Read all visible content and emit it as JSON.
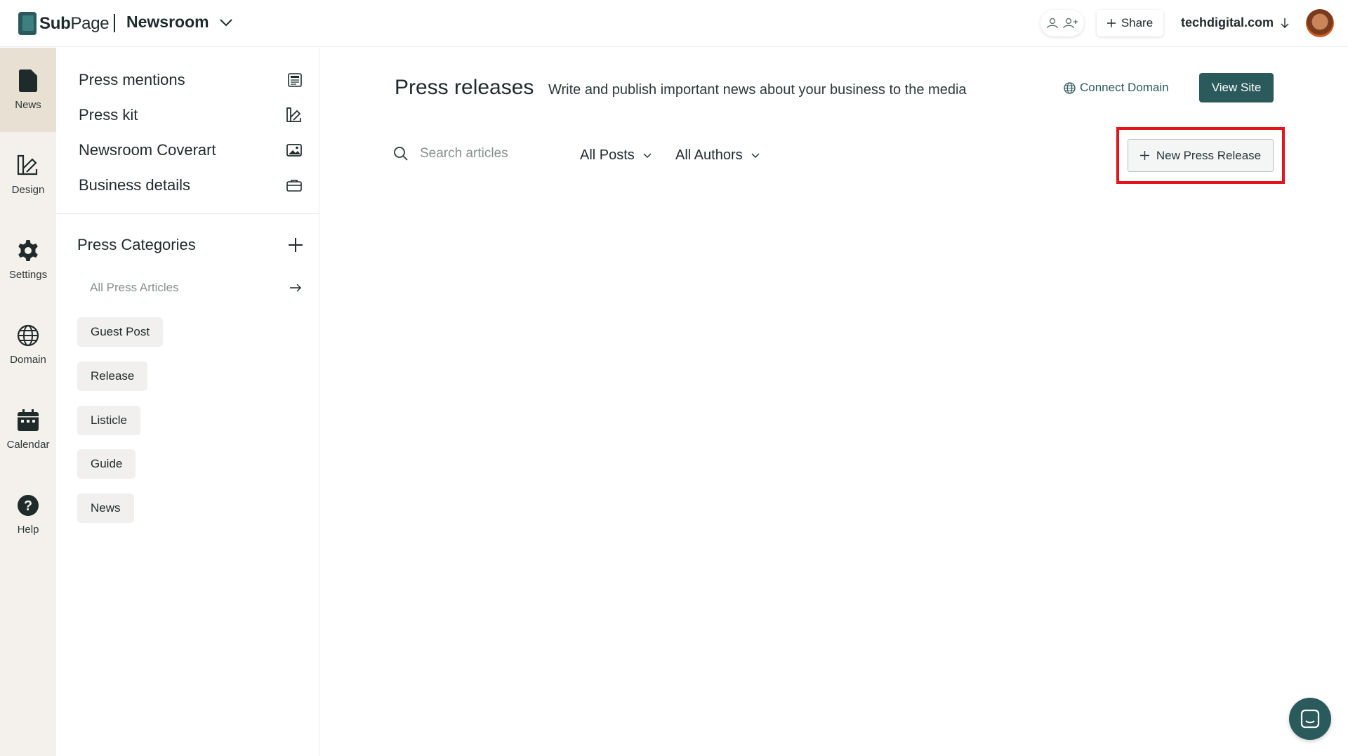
{
  "header": {
    "logo_text_bold": "Sub",
    "logo_text_rest": "Page",
    "workspace": "Newsroom",
    "share_label": "Share",
    "domain": "techdigital.com"
  },
  "rail": {
    "items": [
      {
        "label": "News",
        "icon": "document-icon"
      },
      {
        "label": "Design",
        "icon": "design-icon"
      },
      {
        "label": "Settings",
        "icon": "gear-icon"
      },
      {
        "label": "Domain",
        "icon": "globe-icon"
      },
      {
        "label": "Calendar",
        "icon": "calendar-icon"
      },
      {
        "label": "Help",
        "icon": "help-icon"
      }
    ],
    "active": "News"
  },
  "sidebar": {
    "links": [
      {
        "label": "Press mentions",
        "icon": "newspaper-icon"
      },
      {
        "label": "Press kit",
        "icon": "press-kit-icon"
      },
      {
        "label": "Newsroom Coverart",
        "icon": "image-icon"
      },
      {
        "label": "Business details",
        "icon": "briefcase-icon"
      }
    ],
    "categories_title": "Press Categories",
    "all_articles": "All Press Articles",
    "categories": [
      "Guest Post",
      "Release",
      "Listicle",
      "Guide",
      "News"
    ]
  },
  "main": {
    "title": "Press releases",
    "subtitle": "Write and publish important news about your business to the media",
    "connect_domain": "Connect Domain",
    "view_site": "View Site",
    "search_placeholder": "Search articles",
    "filter_posts": "All Posts",
    "filter_authors": "All Authors",
    "new_release": "New Press Release"
  },
  "colors": {
    "brand": "#2b5a5c",
    "rail_bg": "#f4f1ec",
    "rail_active": "#e8e0d2",
    "highlight": "#e3141b"
  }
}
